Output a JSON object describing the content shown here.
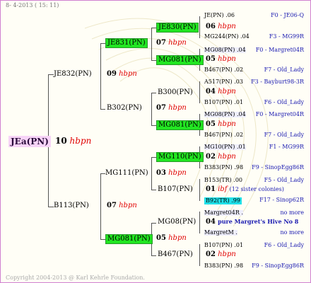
{
  "header": {
    "date": "8-  4-2013 ( 15: 11)"
  },
  "footer": {
    "copyright": "Copyright 2004-2013 @ Karl Kehrle Foundation."
  },
  "root": {
    "name": "JEa(PN)",
    "year": "10",
    "tag": "hbpn"
  },
  "gen1": {
    "a": {
      "name": "JE832(PN)",
      "year": "09",
      "tag": "hbpn"
    },
    "b": {
      "name": "B113(PN)",
      "year": "07",
      "tag": "hbpn"
    }
  },
  "gen2": {
    "a": {
      "name": "JE831(PN)",
      "year": "07",
      "tag": "hbpn"
    },
    "b": {
      "name": "B302(PN)",
      "year": "07",
      "tag": "hbpn"
    },
    "c": {
      "name": "MG111(PN)",
      "year": "03",
      "tag": "hbpn"
    },
    "d": {
      "name": "MG081(PN)",
      "year": "05",
      "tag": "hbpn"
    }
  },
  "gen3": {
    "a": {
      "name": "JE830(PN)",
      "year": "06",
      "tag": "hbpn"
    },
    "b": {
      "name": "MG081(PN)",
      "year": "05",
      "tag": "hbpn"
    },
    "c": {
      "name": "B300(PN)",
      "year": "04",
      "tag": "hbpn"
    },
    "d": {
      "name": "MG081(PN)",
      "year": "05",
      "tag": "hbpn"
    },
    "e": {
      "name": "MG110(PN)",
      "year": "02",
      "tag": "hbpn"
    },
    "f": {
      "name": "B107(PN)",
      "year": "01",
      "tag": "hbpn"
    },
    "g": {
      "name": "MG08(PN)",
      "year": "04",
      "tag": "hbpn"
    },
    "h": {
      "name": "B467(PN)",
      "year": "02",
      "tag": "hbpn"
    }
  },
  "gen4": [
    {
      "name": "JE(PN)",
      "code": ".06",
      "info": "F0 - JE06-Q"
    },
    {
      "name": "MG244(PN)",
      "code": ".04",
      "info": "F3 - MG99R"
    },
    {
      "name": "MG08(PN)",
      "code": ".04",
      "info": "F0 - Margret04R"
    },
    {
      "name": "B467(PN)",
      "code": ".02",
      "info": "F7 - Old_Lady"
    },
    {
      "name": "A517(PN)",
      "code": ".03",
      "info": "F3 - Bayburt98-3R"
    },
    {
      "name": "B107(PN)",
      "code": ".01",
      "info": "F6 - Old_Lady"
    },
    {
      "name": "MG08(PN)",
      "code": ".04",
      "info": "F0 - Margret04R"
    },
    {
      "name": "B467(PN)",
      "code": ".02",
      "info": "F7 - Old_Lady"
    },
    {
      "name": "MG10(PN)",
      "code": ".01",
      "info": "F1 - MG99R"
    },
    {
      "name": "B383(PN)",
      "code": ".98",
      "info": "F9 - SinopEgg86R"
    },
    {
      "name": "B153(TR)",
      "code": ".00",
      "info": "F5 - Old_Lady"
    },
    {
      "name": "B92(TR)",
      "code": ".99",
      "info": "F17 - Sinop62R"
    },
    {
      "name": "Margret04R",
      "code": ".",
      "info": "no more"
    },
    {
      "name": "MargretM",
      "code": ".",
      "info": "no more"
    },
    {
      "name": "B107(PN)",
      "code": ".01",
      "info": "F6 - Old_Lady"
    },
    {
      "name": "B383(PN)",
      "code": ".98",
      "info": "F9 - SinopEgg86R"
    }
  ],
  "notes": {
    "n01_year": "01",
    "n01_tag": "ibf",
    "n01_text": "(12 sister colonies)",
    "n04_year": "04",
    "n04_text": "pure Margret's Hive No 8"
  }
}
